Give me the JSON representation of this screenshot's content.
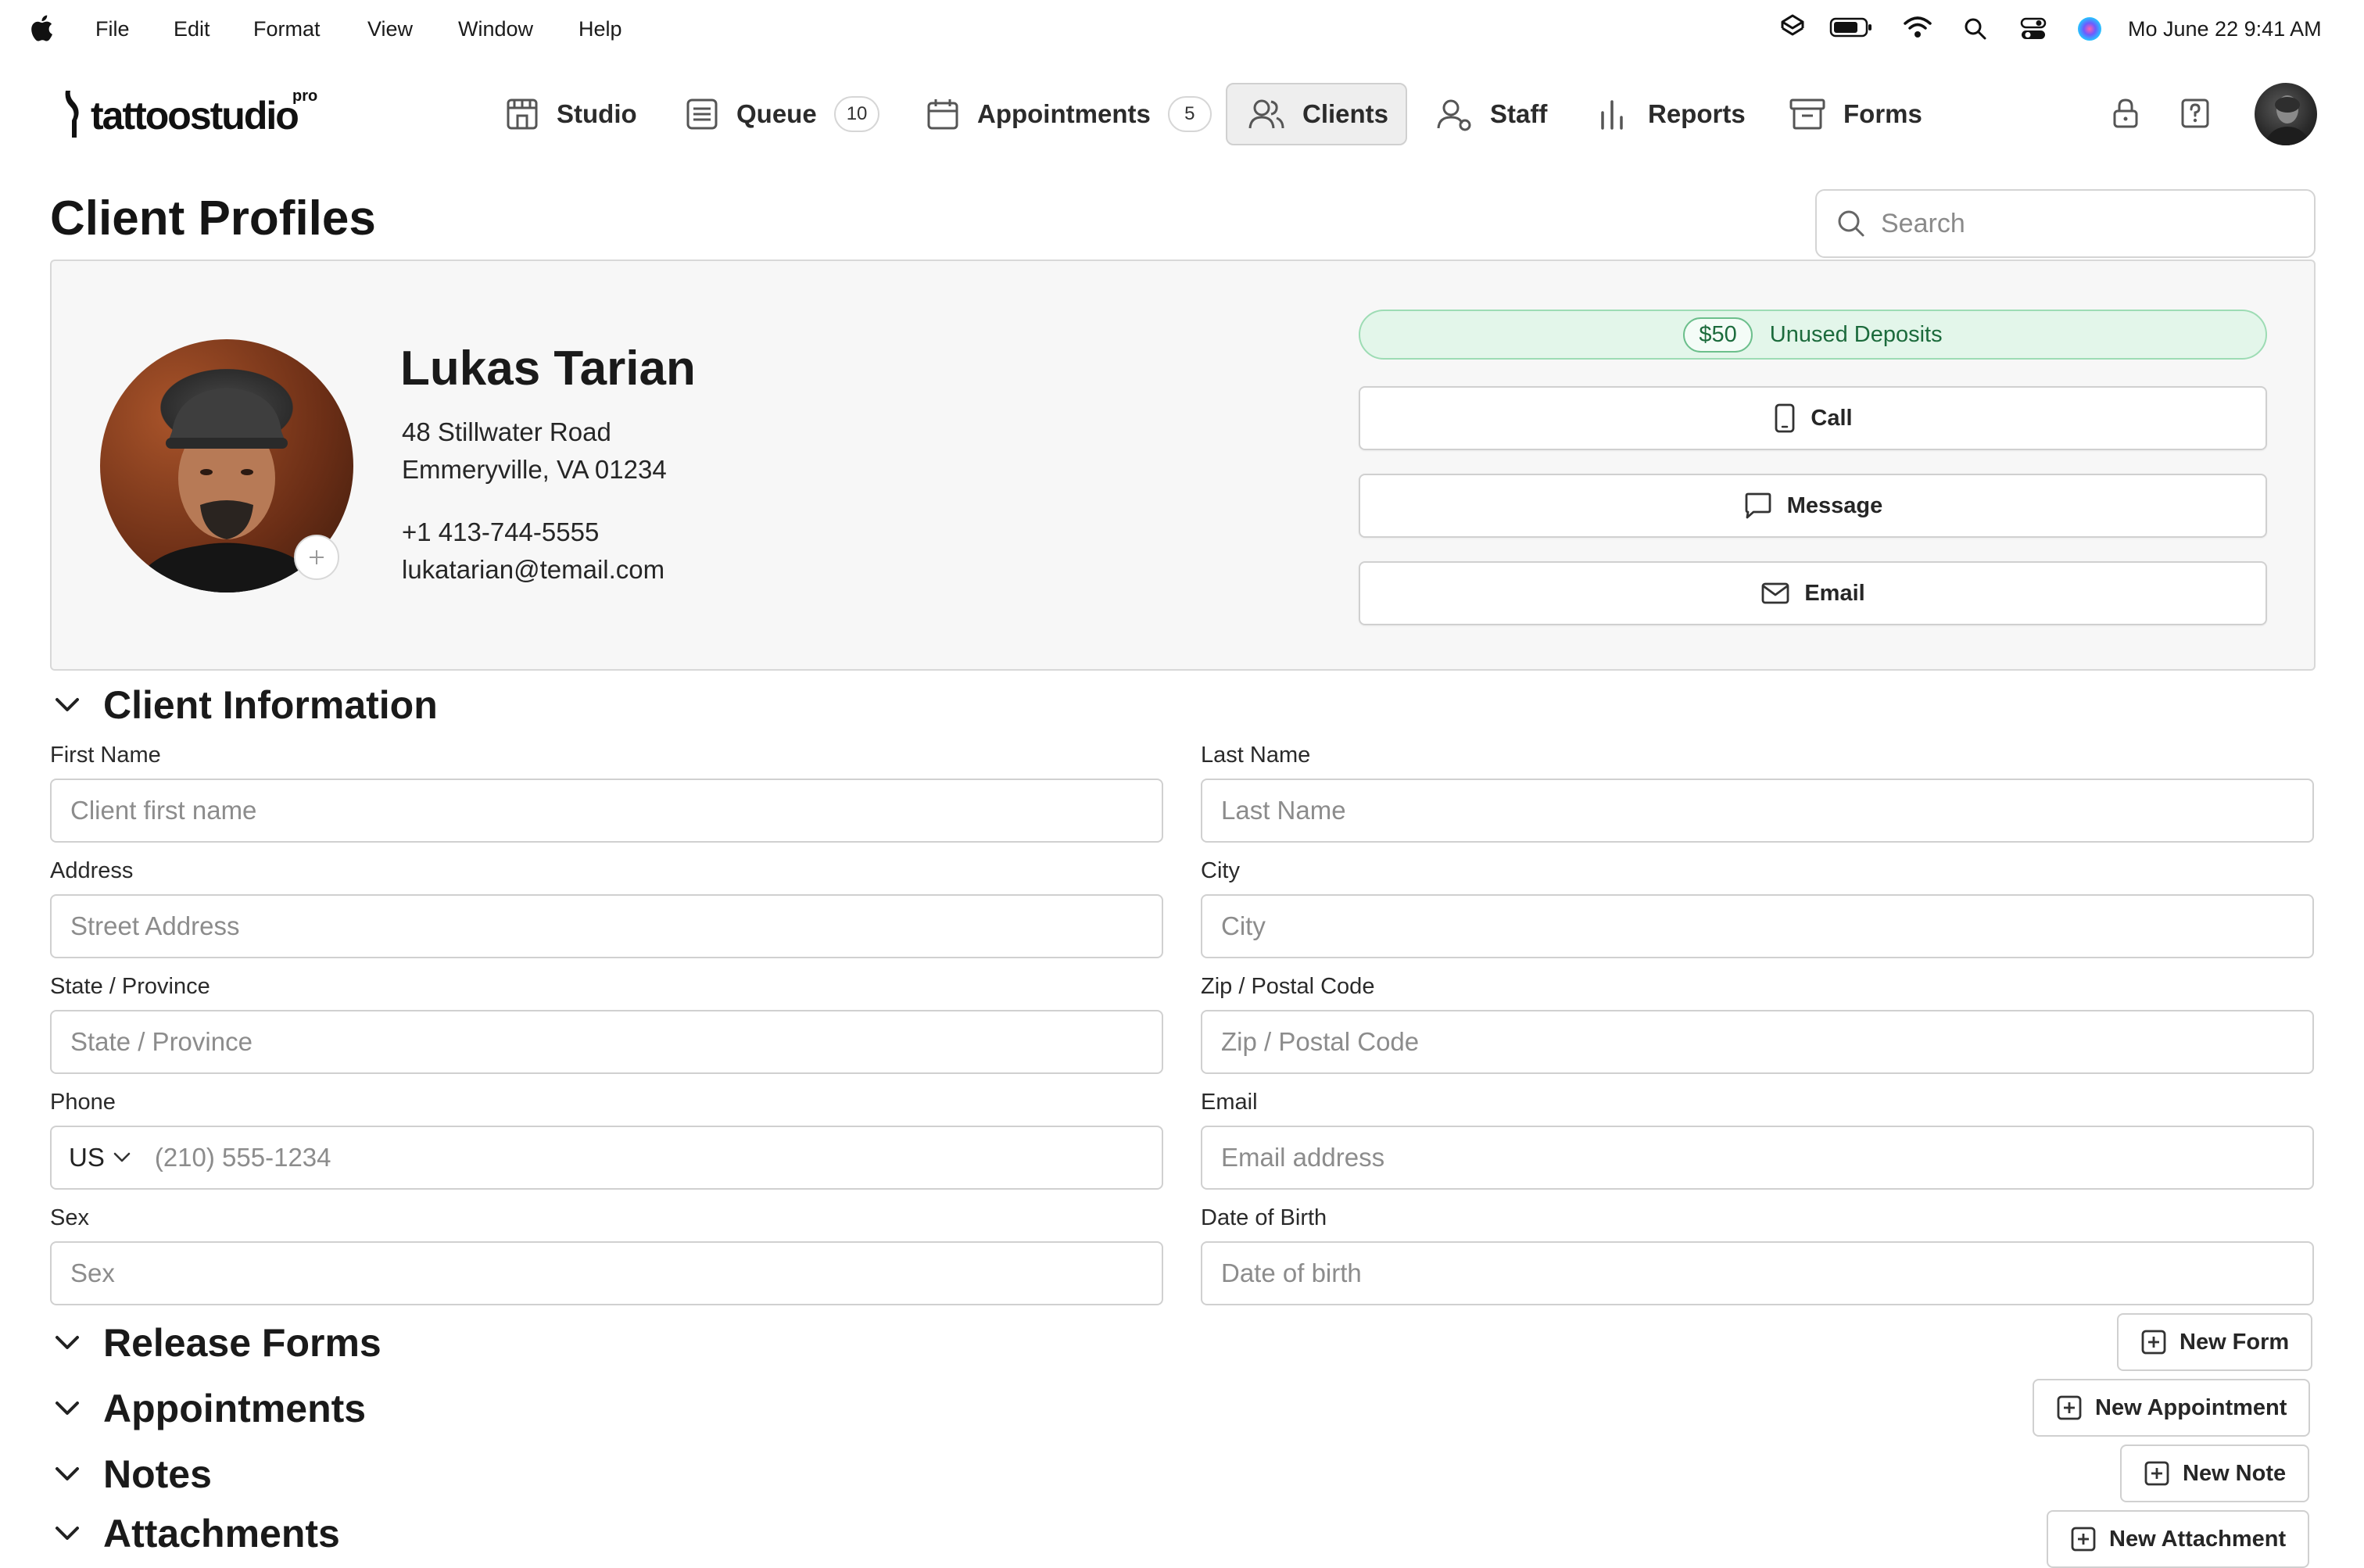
{
  "menubar": {
    "items": [
      "File",
      "Edit",
      "Format",
      "View",
      "Window",
      "Help"
    ],
    "clock": "Mo June 22  9:41 AM"
  },
  "app": {
    "logo_text": "tattoostudio",
    "logo_badge": "pro"
  },
  "nav": {
    "studio": "Studio",
    "queue": "Queue",
    "queue_count": "10",
    "appointments": "Appointments",
    "appointments_count": "5",
    "clients": "Clients",
    "staff": "Staff",
    "reports": "Reports",
    "forms": "Forms",
    "active": "Clients"
  },
  "page": {
    "title": "Client Profiles",
    "search_placeholder": "Search"
  },
  "client": {
    "name": "Lukas Tarian",
    "address_line1": "48 Stillwater Road",
    "address_line2": "Emmeryville, VA 01234",
    "phone": "+1 413-744-5555",
    "email": "lukatarian@temail.com"
  },
  "deposit": {
    "amount": "$50",
    "label": "Unused Deposits",
    "color": "#1c6b3c"
  },
  "actions": {
    "call": "Call",
    "message": "Message",
    "email": "Email"
  },
  "info": {
    "title": "Client Information",
    "first_name_label": "First Name",
    "first_name_placeholder": "Client first name",
    "last_name_label": "Last Name",
    "last_name_placeholder": "Last Name",
    "address_label": "Address",
    "address_placeholder": "Street Address",
    "city_label": "City",
    "city_placeholder": "City",
    "state_label": "State / Province",
    "state_placeholder": "State / Province",
    "zip_label": "Zip / Postal Code",
    "zip_placeholder": "Zip / Postal Code",
    "phone_label": "Phone",
    "phone_country": "US",
    "phone_placeholder": "(210) 555-1234",
    "email_label": "Email",
    "email_placeholder": "Email address",
    "sex_label": "Sex",
    "sex_placeholder": "Sex",
    "dob_label": "Date of Birth",
    "dob_placeholder": "Date of birth"
  },
  "sections": {
    "release_forms": "Release Forms",
    "new_form": "New Form",
    "appointments": "Appointments",
    "new_appointment": "New Appointment",
    "notes": "Notes",
    "new_note": "New Note",
    "attachments": "Attachments",
    "new_attachment": "New Attachment"
  }
}
